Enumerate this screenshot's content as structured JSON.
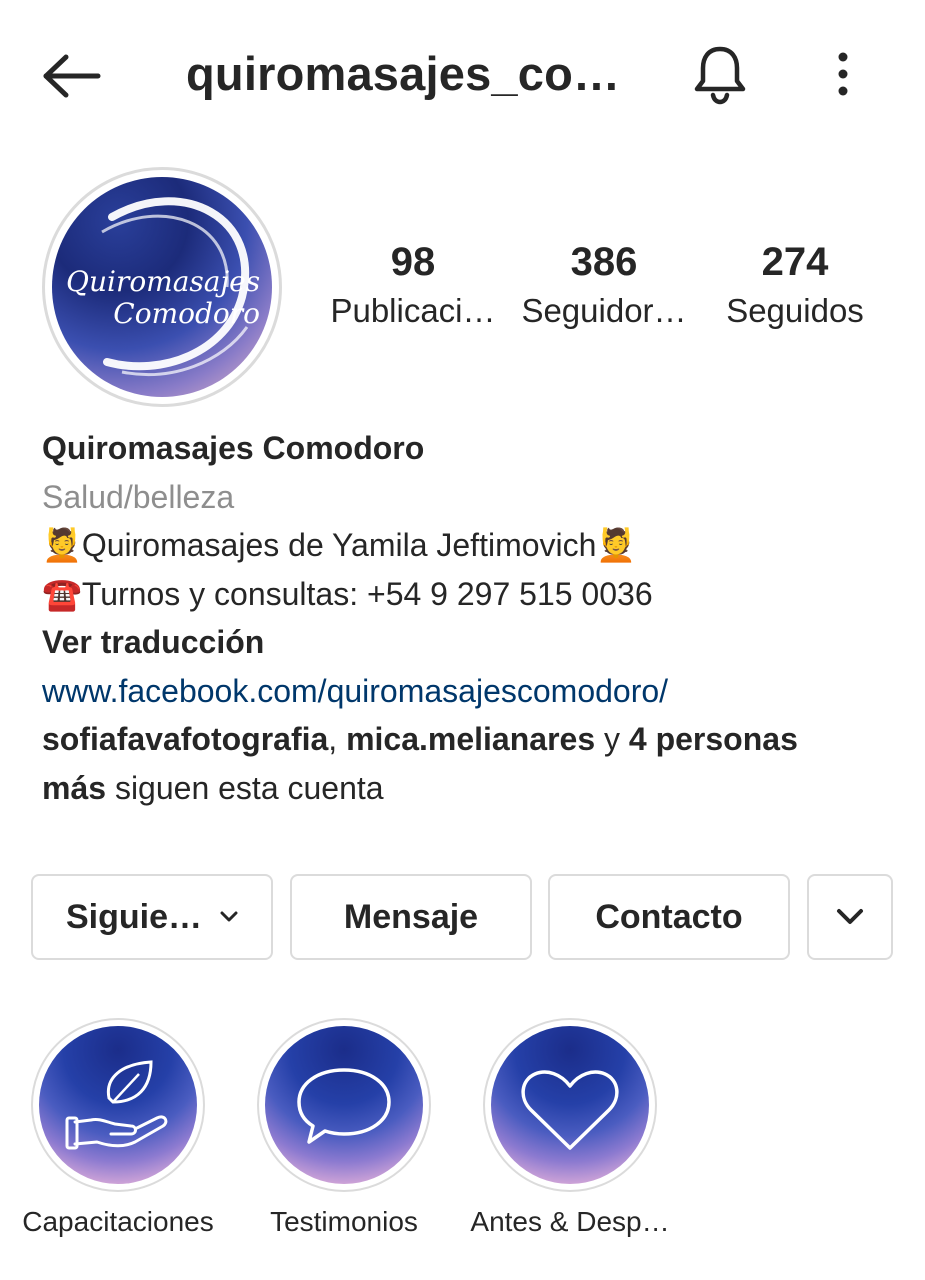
{
  "header": {
    "title": "quiromasajes_co…",
    "icons": {
      "back": "arrow-left-icon",
      "notifications": "bell-icon",
      "more": "kebab-menu-icon"
    }
  },
  "avatar": {
    "line1": "Quiromasajes",
    "line2": "Comodoro"
  },
  "stats": [
    {
      "count": "98",
      "label": "Publicaci…"
    },
    {
      "count": "386",
      "label": "Seguidor…"
    },
    {
      "count": "274",
      "label": "Seguidos"
    }
  ],
  "bio": {
    "name": "Quiromasajes Comodoro",
    "category": "Salud/belleza",
    "line1_emoji": "💆",
    "line1_text": "Quiromasajes de Yamila Jeftimovich",
    "line1_emoji_end": "💆",
    "line2_emoji": "☎️",
    "line2_text": "Turnos y consultas: +54 9 297 515 0036",
    "translate": "Ver traducción",
    "link": "www.facebook.com/quiromasajescomodoro/",
    "followed_by": {
      "user1": "sofiafavafotografia",
      "sep": ", ",
      "user2": "mica.melianares",
      "and": " y ",
      "others": "4 personas",
      "others2": "más",
      "suffix": " siguen esta cuenta"
    }
  },
  "buttons": {
    "following": "Siguie…",
    "message": "Mensaje",
    "contact": "Contacto"
  },
  "highlights": [
    {
      "label": "Capacitaciones",
      "icon": "hand-leaf-icon"
    },
    {
      "label": "Testimonios",
      "icon": "speech-bubble-icon"
    },
    {
      "label": "Antes & Desp…",
      "icon": "heart-icon"
    }
  ],
  "colors": {
    "text": "#262626",
    "muted": "#8e8e8e",
    "link": "#00376b",
    "border": "#dbdbdb"
  }
}
